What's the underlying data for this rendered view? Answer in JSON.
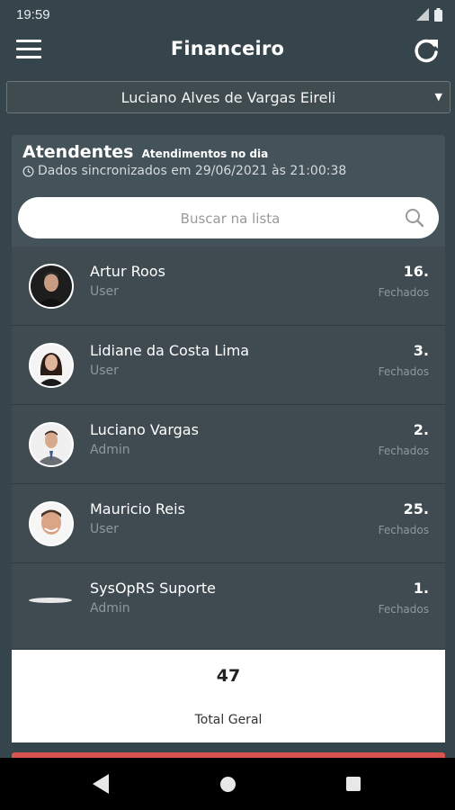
{
  "status_bar": {
    "time": "19:59"
  },
  "app_bar": {
    "title": "Financeiro",
    "menu_icon": "hamburger-menu-icon",
    "refresh_icon": "refresh-icon"
  },
  "company_select": {
    "selected": "Luciano Alves de Vargas Eireli"
  },
  "section": {
    "title": "Atendentes",
    "subtitle": "Atendimentos no dia",
    "sync_text": "Dados sincronizados em 29/06/2021 às 21:00:38"
  },
  "search": {
    "placeholder": "Buscar na lista"
  },
  "attendants": [
    {
      "name": "Artur Roos",
      "role": "User",
      "count": "16.",
      "count_label": "Fechados"
    },
    {
      "name": "Lidiane da Costa Lima",
      "role": "User",
      "count": "3.",
      "count_label": "Fechados"
    },
    {
      "name": "Luciano Vargas",
      "role": "Admin",
      "count": "2.",
      "count_label": "Fechados"
    },
    {
      "name": "Mauricio Reis",
      "role": "User",
      "count": "25.",
      "count_label": "Fechados"
    },
    {
      "name": "SysOpRS Suporte",
      "role": "Admin",
      "count": "1.",
      "count_label": "Fechados"
    }
  ],
  "total": {
    "value": "47",
    "label": "Total Geral"
  },
  "colors": {
    "background": "#36454b",
    "card": "#3f4b50",
    "accent_strip": "#d9534f"
  }
}
